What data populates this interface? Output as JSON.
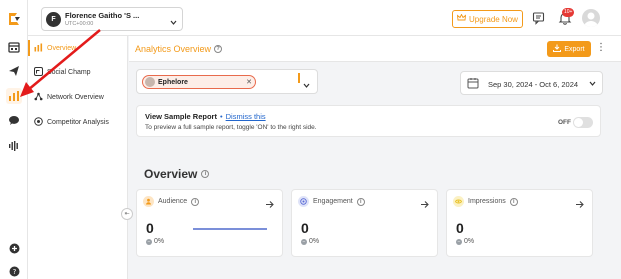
{
  "topbar": {
    "profile": {
      "initial": "F",
      "name": "Florence Gaitho 'S ...",
      "timezone": "UTC+00:00"
    },
    "upgrade_label": "Upgrade Now",
    "notification_count": "10+"
  },
  "subnav": {
    "items": [
      {
        "label": "Overview",
        "icon": "chart-bar-icon",
        "active": true
      },
      {
        "label": "Social Champ",
        "icon": "social-champ-icon",
        "active": false
      },
      {
        "label": "Network Overview",
        "icon": "network-icon",
        "active": false
      },
      {
        "label": "Competitor Analysis",
        "icon": "competitor-icon",
        "active": false
      }
    ]
  },
  "main": {
    "title": "Analytics Overview",
    "export_label": "Export",
    "filter": {
      "account": "Ephelore"
    },
    "date_range": "Sep 30, 2024 - Oct 6, 2024",
    "sample_report": {
      "title": "View Sample Report",
      "dismiss": "Dismiss this",
      "subtitle": "To preview a full sample report, toggle 'ON' to the right side.",
      "toggle_label": "OFF"
    },
    "overview_title": "Overview",
    "cards": [
      {
        "label": "Audience",
        "value": "0",
        "delta": "0%",
        "color": "#f39a1a"
      },
      {
        "label": "Engagement",
        "value": "0",
        "delta": "0%",
        "color": "#5b6bd6"
      },
      {
        "label": "Impressions",
        "value": "0",
        "delta": "0%",
        "color": "#e8c228"
      }
    ]
  },
  "colors": {
    "accent": "#f39a1a",
    "annotation_arrow": "#e31b1b"
  }
}
